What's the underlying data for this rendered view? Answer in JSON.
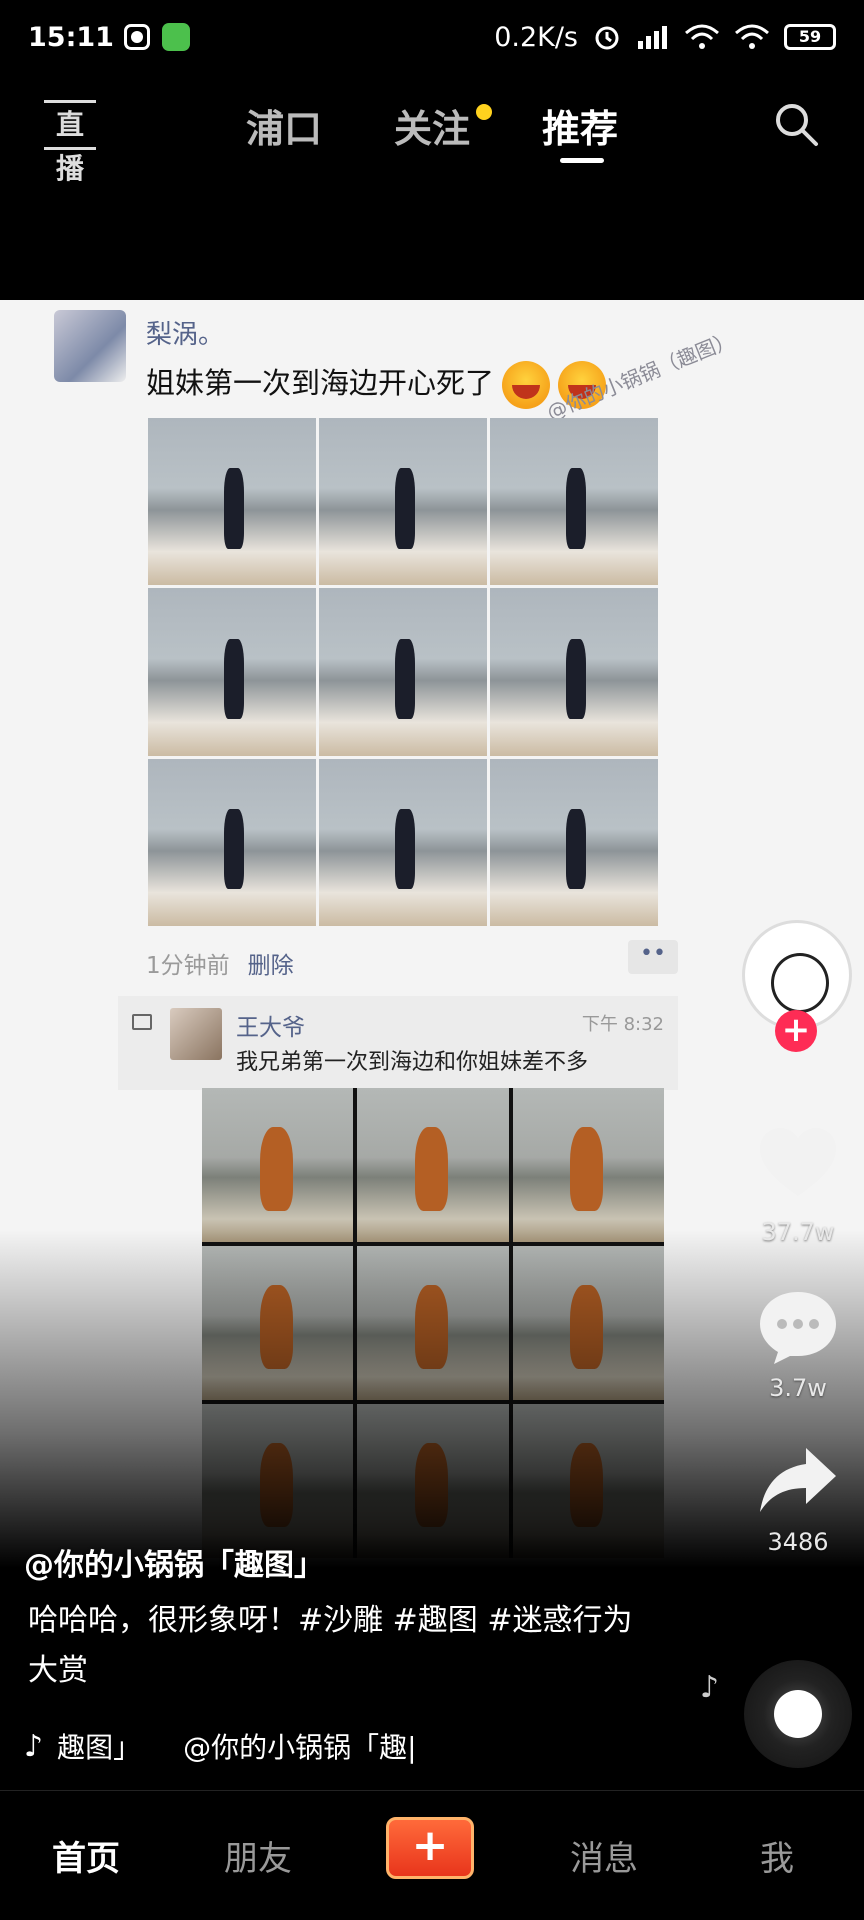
{
  "status_bar": {
    "time": "15:11",
    "network_speed": "0.2K/s",
    "battery": "59"
  },
  "top_nav": {
    "live_label": "直播",
    "tabs": [
      {
        "label": "浦口",
        "active": false
      },
      {
        "label": "关注",
        "active": false
      },
      {
        "label": "推荐",
        "active": true
      }
    ]
  },
  "video": {
    "post": {
      "user": "梨涡。",
      "text": "姐妹第一次到海边开心死了",
      "watermark": "@你的小锅锅（趣图）",
      "time_ago": "1分钟前",
      "delete_label": "删除",
      "more_label": "••"
    },
    "comment": {
      "user": "王大爷",
      "time": "下午 8:32",
      "text": "我兄弟第一次到海边和你姐妹差不多"
    }
  },
  "actions": {
    "likes": "37.7w",
    "comments": "3.7w",
    "shares": "3486",
    "follow_label": "+"
  },
  "caption": {
    "author": "@你的小锅锅「趣图」",
    "text": "哈哈哈，很形象呀！#沙雕 #趣图 #迷惑行为大赏",
    "music_note": "♪",
    "music_tag": "趣图」",
    "music_author": "@你的小锅锅「趣|"
  },
  "tab_bar": {
    "items": [
      {
        "label": "首页",
        "active": true
      },
      {
        "label": "朋友",
        "active": false
      },
      {
        "label": "+",
        "active": false
      },
      {
        "label": "消息",
        "active": false
      },
      {
        "label": "我",
        "active": false
      }
    ]
  },
  "colors": {
    "accent_red": "#fe2c55",
    "notice_yellow": "#ffd21e",
    "link_blue": "#55638a"
  }
}
